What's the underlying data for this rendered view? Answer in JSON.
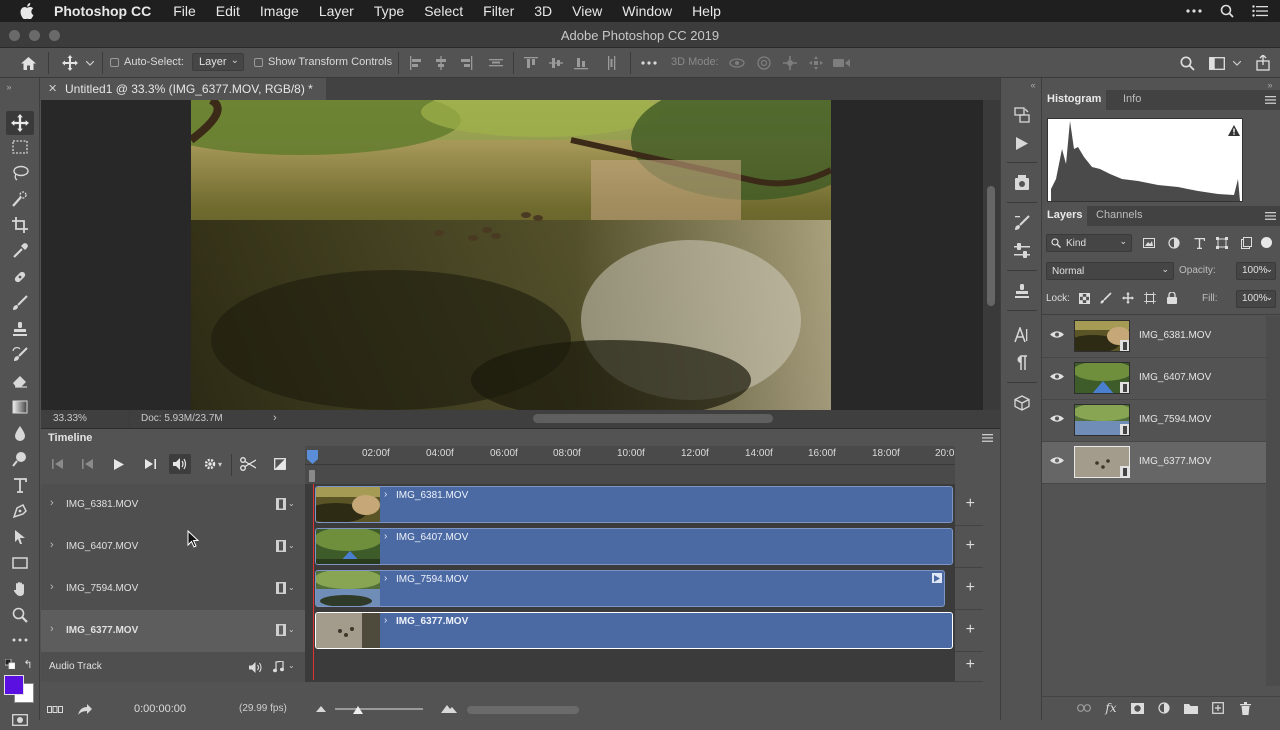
{
  "menubar": {
    "app_name": "Photoshop CC",
    "items": [
      "File",
      "Edit",
      "Image",
      "Layer",
      "Type",
      "Select",
      "Filter",
      "3D",
      "View",
      "Window",
      "Help"
    ]
  },
  "window": {
    "title": "Adobe Photoshop CC 2019"
  },
  "options": {
    "auto_select_label": "Auto-Select:",
    "auto_select_value": "Layer",
    "show_transform_label": "Show Transform Controls",
    "mode_3d_label": "3D Mode:"
  },
  "document": {
    "tab_title": "Untitled1 @ 33.3% (IMG_6377.MOV, RGB/8) *",
    "zoom": "33.33%",
    "doc_size": "Doc: 5.93M/23.7M"
  },
  "timeline": {
    "title": "Timeline",
    "ruler": [
      "02:00f",
      "04:00f",
      "06:00f",
      "08:00f",
      "10:00f",
      "12:00f",
      "14:00f",
      "16:00f",
      "18:00f",
      "20:0"
    ],
    "tracks": [
      {
        "name": "IMG_6381.MOV",
        "clip": "IMG_6381.MOV"
      },
      {
        "name": "IMG_6407.MOV",
        "clip": "IMG_6407.MOV"
      },
      {
        "name": "IMG_7594.MOV",
        "clip": "IMG_7594.MOV"
      },
      {
        "name": "IMG_6377.MOV",
        "clip": "IMG_6377.MOV"
      }
    ],
    "audio_track": "Audio Track",
    "timecode": "0:00:00:00",
    "fps": "(29.99 fps)"
  },
  "panels": {
    "histogram_tab": "Histogram",
    "info_tab": "Info",
    "layers_tab": "Layers",
    "channels_tab": "Channels",
    "kind_filter": "Kind",
    "blend_mode": "Normal",
    "opacity_label": "Opacity:",
    "opacity_value": "100%",
    "lock_label": "Lock:",
    "fill_label": "Fill:",
    "fill_value": "100%",
    "layers": [
      "IMG_6381.MOV",
      "IMG_6407.MOV",
      "IMG_7594.MOV",
      "IMG_6377.MOV"
    ],
    "selected_layer": "IMG_6377.MOV"
  },
  "colors": {
    "clip_blue": "#4b6aa3",
    "foreground_swatch": "#5a10e0",
    "background_swatch": "#ffffff"
  }
}
